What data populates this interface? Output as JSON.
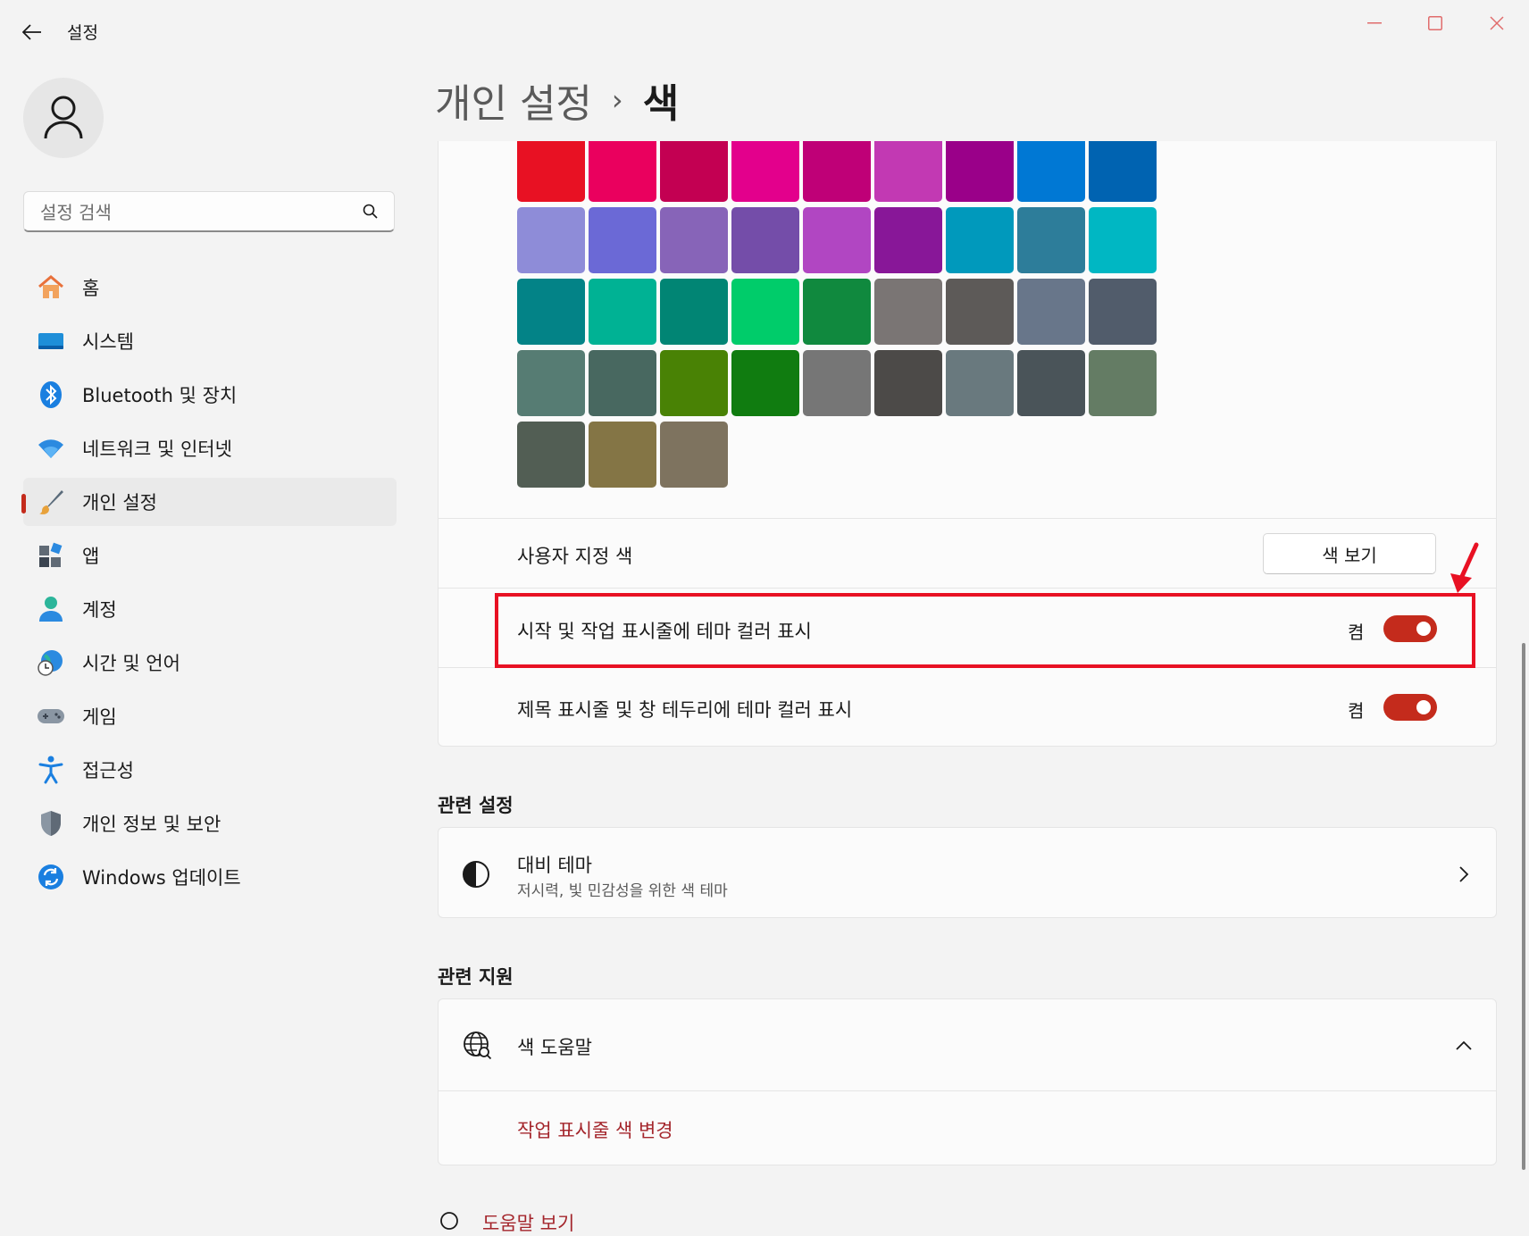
{
  "window": {
    "title": "설정"
  },
  "sidebar": {
    "search_placeholder": "설정 검색",
    "items": [
      {
        "label": "홈",
        "icon": "home-icon"
      },
      {
        "label": "시스템",
        "icon": "system-icon"
      },
      {
        "label": "Bluetooth 및 장치",
        "icon": "bluetooth-icon"
      },
      {
        "label": "네트워크 및 인터넷",
        "icon": "wifi-icon"
      },
      {
        "label": "개인 설정",
        "icon": "brush-icon",
        "active": true
      },
      {
        "label": "앱",
        "icon": "apps-icon"
      },
      {
        "label": "계정",
        "icon": "account-icon"
      },
      {
        "label": "시간 및 언어",
        "icon": "time-language-icon"
      },
      {
        "label": "게임",
        "icon": "gamepad-icon"
      },
      {
        "label": "접근성",
        "icon": "accessibility-icon"
      },
      {
        "label": "개인 정보 및 보안",
        "icon": "shield-icon"
      },
      {
        "label": "Windows 업데이트",
        "icon": "update-icon"
      }
    ]
  },
  "header": {
    "parent": "개인 설정",
    "separator": "›",
    "current": "색"
  },
  "palette": {
    "colors": [
      "#e81123",
      "#ea005e",
      "#c30052",
      "#e3008c",
      "#bf0077",
      "#c239b3",
      "#9a0089",
      "#0078d4",
      "#0063b1",
      "#8e8cd8",
      "#6b69d6",
      "#8764b8",
      "#744da9",
      "#b146c2",
      "#881798",
      "#0099bc",
      "#2d7d9a",
      "#00b7c3",
      "#038387",
      "#00b294",
      "#018574",
      "#00cc6a",
      "#10893e",
      "#7a7574",
      "#5d5a58",
      "#68768a",
      "#515c6b",
      "#567c73",
      "#486860",
      "#498205",
      "#107c10",
      "#767676",
      "#4c4a48",
      "#69797e",
      "#4a5459",
      "#647c64",
      "#525e54",
      "#847545",
      "#7e735f"
    ]
  },
  "custom_color": {
    "label": "사용자 지정 색",
    "button": "색 보기"
  },
  "toggles": {
    "start_taskbar": {
      "label": "시작 및 작업 표시줄에 테마 컬러 표시",
      "state": "켬",
      "on": true
    },
    "title_bars": {
      "label": "제목 표시줄 및 창 테두리에 테마 컬러 표시",
      "state": "켬",
      "on": true
    }
  },
  "related_settings": {
    "title": "관련 설정",
    "contrast": {
      "title": "대비 테마",
      "subtitle": "저시력, 빛 민감성을 위한 색 테마"
    }
  },
  "related_support": {
    "title": "관련 지원",
    "help": {
      "title": "색 도움말",
      "link": "작업 표시줄 색 변경"
    }
  },
  "footer": {
    "get_help": "도움말 보기"
  },
  "colors": {
    "accent": "#c42b1c",
    "highlight": "#e81123",
    "link": "#a4262c"
  }
}
